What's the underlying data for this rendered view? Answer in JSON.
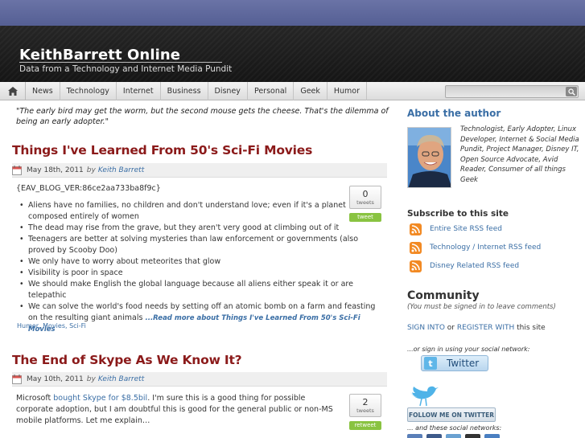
{
  "header": {
    "site_title": "KeithBarrett Online",
    "tagline": "Data from a Technology and Internet Media Pundit"
  },
  "nav": {
    "items": [
      "News",
      "Technology",
      "Internet",
      "Business",
      "Disney",
      "Personal",
      "Geek",
      "Humor"
    ],
    "search_placeholder": ""
  },
  "main": {
    "quote": "\"The early bird may get the worm, but the second mouse gets the cheese. That's the dilemma of being an early adopter.\"",
    "posts": [
      {
        "title": "Things I've Learned From 50's Sci-Fi Movies",
        "date": "May 18th, 2011",
        "by": "by",
        "author": "Keith Barrett",
        "ver": "{EAV_BLOG_VER:86ce2aa733ba8f9c}",
        "bullets": [
          "Aliens have no families, no children and don't understand love; even if it's a planet composed entirely of women",
          "The dead may rise from the grave, but they aren't very good at climbing out of it",
          "Teenagers are better at solving mysteries than law enforcement or governments (also proved by Scooby Doo)",
          "We only have to worry about meteorites that glow",
          "Visibility is poor in space",
          "We should make English the global language because all aliens either speak it or are telepathic",
          "We can solve the world's food needs by setting off an atomic bomb on a farm and feasting on the resulting giant animals"
        ],
        "read_more": "...Read more about Things I've Learned From 50's Sci-Fi Movies",
        "tags": "Humor, Movies, Sci-Fi",
        "tweet_count": "0",
        "tweet_label": "tweets",
        "tweet_button": "tweet"
      },
      {
        "title": "The End of Skype As We Know It?",
        "date": "May 10th, 2011",
        "by": "by",
        "author": "Keith Barrett",
        "text_before": "Microsoft ",
        "link_text": "bought Skype for $8.5bil",
        "text_after": ". I'm sure this is a good thing for possible corporate adoption, but I am doubtful this is good for the general public or non-MS mobile platforms. Let me explain…",
        "tweet_count": "2",
        "tweet_label": "tweets",
        "tweet_button": "retweet"
      }
    ]
  },
  "sidebar": {
    "about_heading": "About the author",
    "author_bio": "Technologist, Early Adopter, Linux Developer, Internet & Social Media Pundit, Project Manager, Disney IT, Open Source Advocate, Avid Reader, Consumer of all things Geek",
    "subscribe_heading": "Subscribe to this site",
    "feeds": [
      "Entire Site RSS feed",
      "Technology / Internet RSS feed",
      "Disney Related RSS feed"
    ],
    "community_heading": "Community",
    "community_note": "(You must be signed in to leave comments)",
    "sign_into": "SIGN INTO",
    "or": " or ",
    "register_with": "REGISTER WITH",
    "this_site": " this site",
    "social_signin_note": "...or sign in using your social network:",
    "twitter_button": "Twitter",
    "follow_button": "FOLLOW ME ON TWITTER",
    "other_networks_note": "... and these social networks:"
  },
  "colors": {
    "accent_blue": "#3a6ea5",
    "post_title": "#8b1a1a",
    "rss_orange": "#f28a24",
    "tweet_green": "#89c341"
  }
}
